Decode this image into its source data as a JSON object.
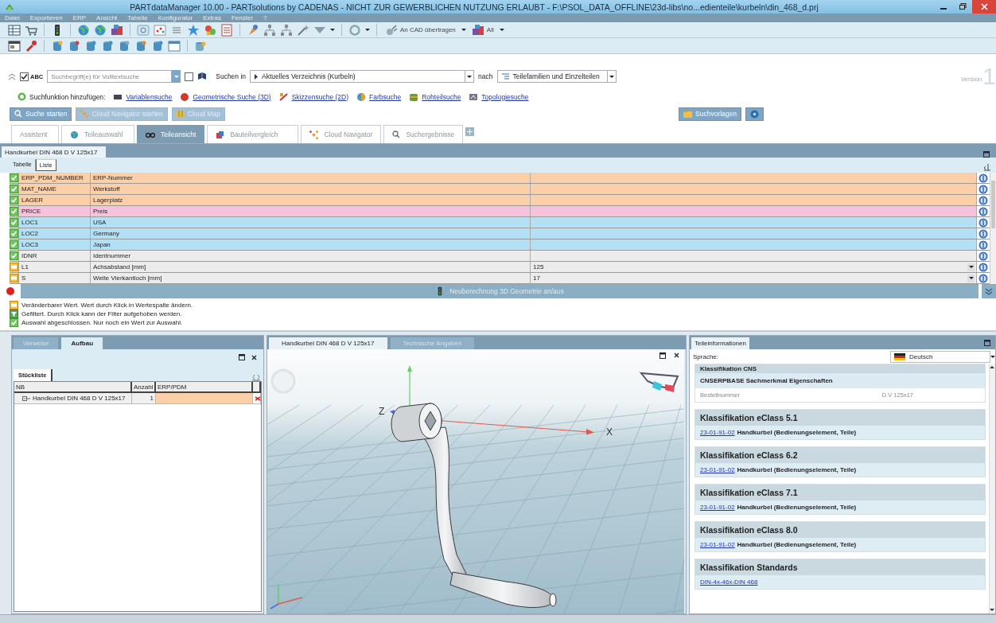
{
  "window": {
    "title": "PARTdataManager 10.00 - PARTsolutions by CADENAS - NICHT ZUR GEWERBLICHEN NUTZUNG ERLAUBT - F:\\PSOL_DATA_OFFLINE\\23d-libs\\no...edienteile\\kurbeln\\din_468_d.prj"
  },
  "menu": [
    "Datei",
    "Exportieren",
    "ERP",
    "Ansicht",
    "Tabelle",
    "Konfigurator",
    "Extras",
    "Fenster",
    "?"
  ],
  "toolbar": {
    "transfer_button": "An CAD übertragen",
    "all_button": "All"
  },
  "search": {
    "abc_checked": true,
    "abc_label": "ABC",
    "placeholder": "Suchbegriff(e) für Volltextsuche",
    "exact_checked": false,
    "search_in_label": "Suchen in",
    "scope": "Aktuelles Verzeichnis (Kurbeln)",
    "after_label": "nach",
    "target": "Teilefamilien und Einzelteilen",
    "version_label": "Version",
    "version_number": "1"
  },
  "add_search": {
    "label": "Suchfunktion hinzufügen:",
    "links": [
      {
        "kind": "variable",
        "label": "Variablensuche"
      },
      {
        "kind": "geometry",
        "label": "Geometrische Suche (3D)"
      },
      {
        "kind": "sketch",
        "label": "Skizzensuche (2D)"
      },
      {
        "kind": "color",
        "label": "Farbsuche"
      },
      {
        "kind": "raw",
        "label": "Rohteilsuche"
      },
      {
        "kind": "topology",
        "label": "Topologiesuche"
      }
    ]
  },
  "search_buttons": [
    {
      "kind": "search",
      "label": "Suche starten",
      "disabled": false
    },
    {
      "kind": "cloud",
      "label": "Cloud Navigator starten",
      "disabled": true
    },
    {
      "kind": "map",
      "label": "Cloud Map",
      "disabled": true
    }
  ],
  "templates_button": "Suchvorlagen",
  "tabs": [
    {
      "kind": "plain",
      "label": "Assistent",
      "selected": false
    },
    {
      "kind": "globe",
      "label": "Teileauswahl",
      "selected": false
    },
    {
      "kind": "view",
      "label": "Teileansicht",
      "selected": true
    },
    {
      "kind": "compare",
      "label": "Bauteilvergleich",
      "selected": false
    },
    {
      "kind": "cloud",
      "label": "Cloud Navigator",
      "selected": false
    },
    {
      "kind": "search",
      "label": "Suchergebnisse",
      "selected": false
    }
  ],
  "document": {
    "tab": "Handkurbel DIN 468 D V 125x17",
    "view_tabs": [
      {
        "label": "Tabelle",
        "selected": false
      },
      {
        "label": "Liste",
        "selected": true
      }
    ],
    "rows": [
      {
        "kind": "fixed",
        "color": "#fbd0a8",
        "name": "ERP_PDM_NUMBER",
        "description": "ERP-Nummer"
      },
      {
        "kind": "fixed",
        "color": "#fbd0a8",
        "name": "MAT_NAME",
        "description": "Werkstoff"
      },
      {
        "kind": "fixed",
        "color": "#fbd0a8",
        "name": "LAGER",
        "description": "Lagerplatz"
      },
      {
        "kind": "fixed",
        "color": "#f6c3dc",
        "name": "PRICE",
        "description": "Preis"
      },
      {
        "kind": "fixed",
        "color": "#b3e0f4",
        "name": "LOC1",
        "description": "USA"
      },
      {
        "kind": "fixed",
        "color": "#b3e0f4",
        "name": "LOC2",
        "description": "Germany"
      },
      {
        "kind": "fixed",
        "color": "#b3e0f4",
        "name": "LOC3",
        "description": "Japan"
      },
      {
        "kind": "fixed",
        "color": "#ececec",
        "name": "IDNR",
        "description": "Identnummer"
      },
      {
        "kind": "editable",
        "color": "#ececec",
        "name": "L1",
        "description": "Achsabstand [mm]",
        "value": "125",
        "dropdown": true
      },
      {
        "kind": "editable",
        "color": "#ececec",
        "name": "S",
        "description": "Weite Vierkantloch [mm]",
        "value": "17",
        "dropdown": true
      }
    ],
    "recalc_label": "Neuberechnung 3D Geometrie an/aus"
  },
  "legend": [
    {
      "kind": "editable",
      "text": "Veränderbarer Wert. Wert durch Klick in Wertespalte ändern."
    },
    {
      "kind": "filtered",
      "text": "Gefiltert. Durch Klick kann der Filter aufgehoben werden."
    },
    {
      "kind": "fixed",
      "text": "Auswahl abgeschlossen. Nur noch ein Wert zur Auswahl."
    }
  ],
  "structure": {
    "tabs": [
      {
        "label": "Verweise",
        "selected": false
      },
      {
        "label": "Aufbau",
        "selected": true
      }
    ],
    "subtab": "Stückliste",
    "columns": [
      "NB",
      "Anzahl",
      "ERP/PDM"
    ],
    "rows": [
      {
        "name": "Handkurbel DIN 468 D V 125x17",
        "count": "1"
      }
    ]
  },
  "viewer": {
    "tabs": [
      {
        "label": "Handkurbel DIN 468 D V 125x17",
        "selected": true
      },
      {
        "label": "Technische Angaben",
        "selected": false
      }
    ],
    "axis_z": "Z",
    "axis_x": "X"
  },
  "info": {
    "tab": "Teileinformationen",
    "language_label": "Sprache:",
    "language": "Deutsch",
    "sections": [
      {
        "title": "Klassifikation CNS",
        "subtitle": "CNSERPBASE Sachmerkmal Eigenschaften",
        "properties": [
          {
            "name": "Bestellnummer",
            "value": "D V 125x17"
          }
        ]
      },
      {
        "title": "Klassifikation eClass 5.1",
        "entries": [
          {
            "code": "23-01-91-02",
            "text": "Handkurbel (Bedienungselement, Teile)"
          }
        ]
      },
      {
        "title": "Klassifikation eClass 6.2",
        "entries": [
          {
            "code": "23-01-91-02",
            "text": "Handkurbel (Bedienungselement, Teile)"
          }
        ]
      },
      {
        "title": "Klassifikation eClass 7.1",
        "entries": [
          {
            "code": "23-01-91-02",
            "text": "Handkurbel (Bedienungselement, Teile)"
          }
        ]
      },
      {
        "title": "Klassifikation eClass 8.0",
        "entries": [
          {
            "code": "23-01-91-02",
            "text": "Handkurbel (Bedienungselement, Teile)"
          }
        ]
      },
      {
        "title": "Klassifikation Standards",
        "entries": [
          {
            "code": "DIN-4x-46x-DIN 468"
          }
        ]
      }
    ]
  }
}
